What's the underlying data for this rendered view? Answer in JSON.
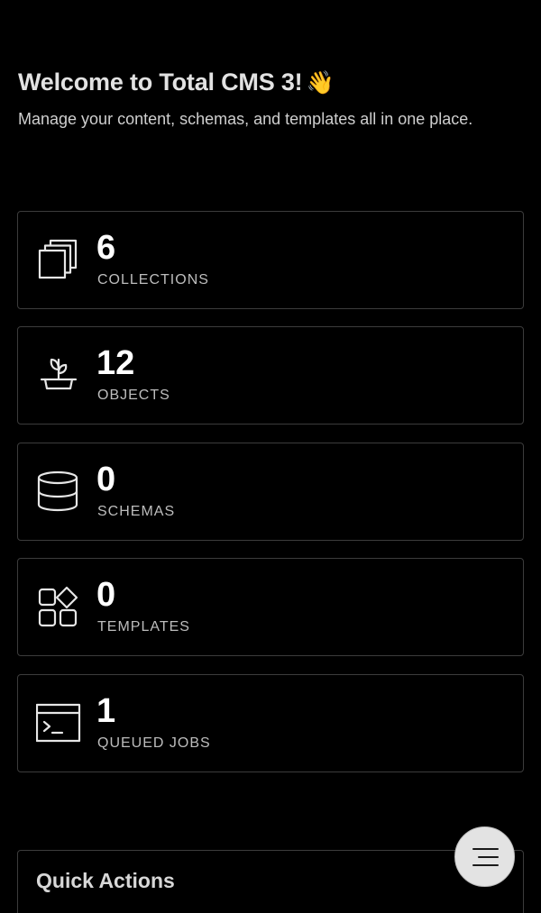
{
  "header": {
    "title": "Welcome to Total CMS 3!",
    "emoji": "👋",
    "subtitle": "Manage your content, schemas, and templates all in one place."
  },
  "stats": [
    {
      "count": "6",
      "label": "COLLECTIONS",
      "icon": "collections-icon"
    },
    {
      "count": "12",
      "label": "OBJECTS",
      "icon": "sprout-icon"
    },
    {
      "count": "0",
      "label": "SCHEMAS",
      "icon": "database-icon"
    },
    {
      "count": "0",
      "label": "TEMPLATES",
      "icon": "shapes-icon"
    },
    {
      "count": "1",
      "label": "QUEUED JOBS",
      "icon": "terminal-icon"
    }
  ],
  "quick_actions": {
    "title": "Quick Actions"
  },
  "menu_button": {
    "icon": "menu-icon"
  },
  "colors": {
    "background": "#000000",
    "card_border": "#3c3c3c",
    "fab_background": "#e3e3e3"
  }
}
